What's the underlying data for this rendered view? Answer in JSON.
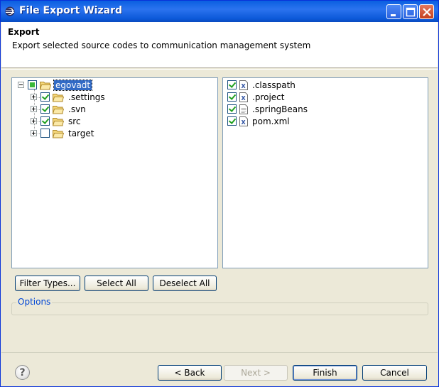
{
  "window": {
    "title": "File Export Wizard",
    "colors": {
      "titlebar": "#0a5fe0",
      "selection": "#316ac5",
      "options_label": "#0046d5"
    }
  },
  "header": {
    "title": "Export",
    "description": "Export selected source codes to communication management system"
  },
  "folder_tree": {
    "root": {
      "label": "egovadt",
      "state": "partial",
      "expanded": true,
      "selected": true
    },
    "items": [
      {
        "label": ".settings",
        "checked": true
      },
      {
        "label": ".svn",
        "checked": true
      },
      {
        "label": "src",
        "checked": true
      },
      {
        "label": "target",
        "checked": false
      }
    ]
  },
  "file_list": {
    "items": [
      {
        "label": ".classpath",
        "checked": true,
        "icon": "xml-file-icon"
      },
      {
        "label": ".project",
        "checked": true,
        "icon": "xml-file-icon"
      },
      {
        "label": ".springBeans",
        "checked": true,
        "icon": "text-file-icon"
      },
      {
        "label": "pom.xml",
        "checked": true,
        "icon": "xml-file-icon"
      }
    ]
  },
  "selection_buttons": {
    "filter_types": "Filter Types...",
    "select_all": "Select All",
    "deselect_all": "Deselect All"
  },
  "options": {
    "label": "Options"
  },
  "footer": {
    "back": "< Back",
    "next": "Next >",
    "finish": "Finish",
    "cancel": "Cancel",
    "help_icon": "?"
  }
}
